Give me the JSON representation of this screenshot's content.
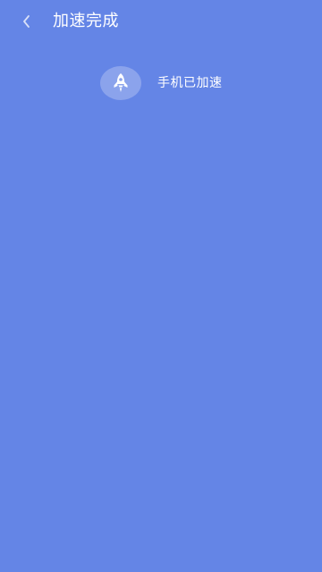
{
  "header": {
    "back_icon": "chevron-left-icon",
    "title": "加速完成"
  },
  "result": {
    "icon": "rocket-icon",
    "message": "手机已加速"
  },
  "colors": {
    "background": "#6485e6",
    "icon_badge": "#8ba3ec",
    "text": "#ffffff"
  }
}
